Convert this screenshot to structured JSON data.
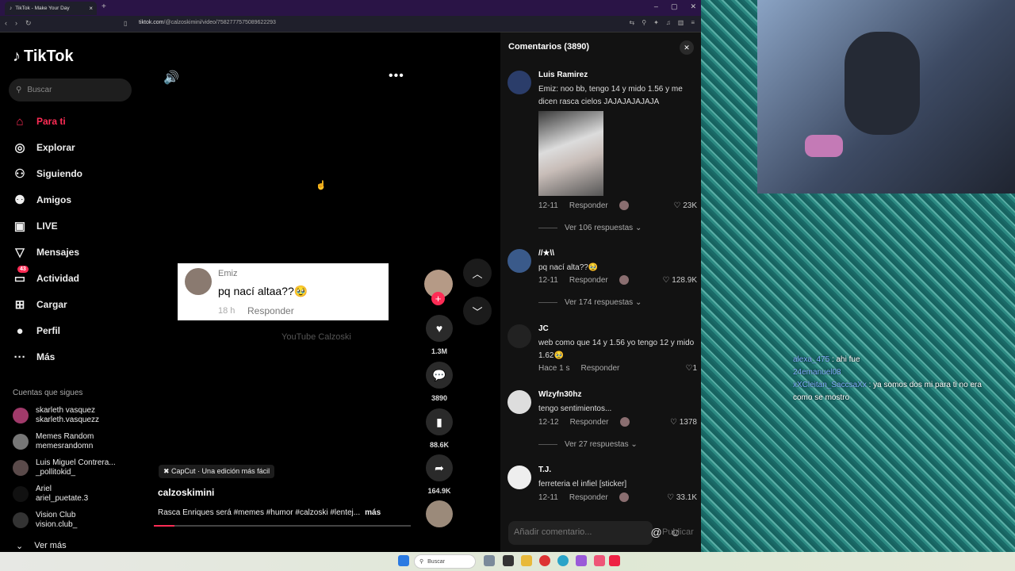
{
  "browser": {
    "tab_title": "TikTok - Make Your Day",
    "url_host": "tiktok.com",
    "url_path": "/@calzoskimini/video/7582777575089622293"
  },
  "app": {
    "logo": "TikTok",
    "search_placeholder": "Buscar"
  },
  "sidebar": {
    "items": [
      {
        "label": "Para ti",
        "icon": "home-icon",
        "active": true
      },
      {
        "label": "Explorar",
        "icon": "compass-icon"
      },
      {
        "label": "Siguiendo",
        "icon": "following-icon"
      },
      {
        "label": "Amigos",
        "icon": "friends-icon"
      },
      {
        "label": "LIVE",
        "icon": "live-icon"
      },
      {
        "label": "Mensajes",
        "icon": "send-icon"
      },
      {
        "label": "Actividad",
        "icon": "activity-icon",
        "badge": "43"
      },
      {
        "label": "Cargar",
        "icon": "upload-icon"
      },
      {
        "label": "Perfil",
        "icon": "profile-icon"
      },
      {
        "label": "Más",
        "icon": "more-icon"
      }
    ],
    "following_title": "Cuentas que sigues",
    "accounts": [
      {
        "name": "skarleth vasquez",
        "handle": "skarleth.vasquezz"
      },
      {
        "name": "Memes Random",
        "handle": "memesrandomn"
      },
      {
        "name": "Luis Miguel Contrera...",
        "handle": "_pollitokid_"
      },
      {
        "name": "Ariel",
        "handle": "ariel_puetate.3"
      },
      {
        "name": "Vision Club",
        "handle": "vision.club_"
      }
    ],
    "see_more": "Ver más"
  },
  "video": {
    "card": {
      "name": "Emiz",
      "text": "pq nací altaa??🥹",
      "time": "18 h",
      "reply": "Responder"
    },
    "watermark": "YouTube Calzoski",
    "capcut": "CapCut · Una edición más fácil",
    "author": "calzoskimini",
    "description": "Rasca Enriques será #memes #humor #calzoski #lentej...",
    "more": "más",
    "progress": 0.08,
    "likes": "1.3M",
    "comments": "3890",
    "saves": "88.6K",
    "shares": "164.9K"
  },
  "comments": {
    "title": "Comentarios (3890)",
    "list": [
      {
        "name": "Luis Ramirez",
        "text": "Emiz: noo bb, tengo 14 y mido 1.56 y me dicen rasca cielos JAJAJAJAJAJA",
        "date": "12-11",
        "reply": "Responder",
        "likes": "23K",
        "replies": "Ver 106 respuestas"
      },
      {
        "name": "//★\\\\",
        "text": "pq nací alta??🥹",
        "date": "12-11",
        "reply": "Responder",
        "likes": "128.9K",
        "replies": "Ver 174 respuestas"
      },
      {
        "name": "JC",
        "text": "web como que 14 y 1.56 yo tengo 12 y mido 1.62🥹",
        "date": "Hace 1 s",
        "reply": "Responder",
        "likes": "1"
      },
      {
        "name": "Wlzyfn30hz",
        "text": "tengo sentimientos...",
        "date": "12-12",
        "reply": "Responder",
        "likes": "1378",
        "replies": "Ver 27 respuestas"
      },
      {
        "name": "T.J.",
        "text": "ferreteria el infiel [sticker]",
        "date": "12-11",
        "reply": "Responder",
        "likes": "33.1K"
      }
    ],
    "input_placeholder": "Añadir comentario...",
    "publish": "Publicar"
  },
  "stream_chat": [
    {
      "user": "alexa_475",
      "msg": ": ahi fue"
    },
    {
      "user": "24emanuel08",
      "msg": ""
    },
    {
      "user": "xXCleitan_SaccsaXx",
      "msg": ": ya somos dos mi para ti no era como se mostro"
    }
  ],
  "taskbar": {
    "search": "Buscar"
  }
}
